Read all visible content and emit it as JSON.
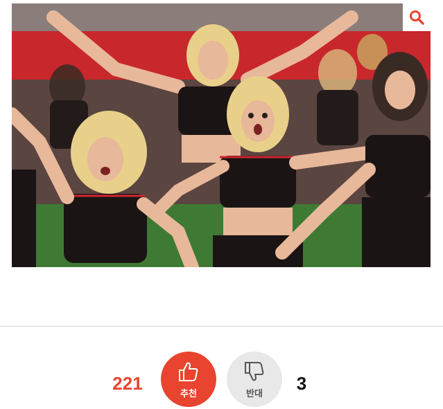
{
  "photo": {
    "icon": "cheerleaders-photo",
    "zoom_icon": "magnifier-icon",
    "colors": {
      "stadium_red": "#c8282c",
      "field_green": "#3f7a35",
      "uniform_black": "#1a1414",
      "uniform_trim": "#d3262f",
      "skin": "#e8b89a",
      "hair": "#e9d08a"
    }
  },
  "votes": {
    "up_count": "221",
    "up_label": "추천",
    "up_icon": "thumbs-up-icon",
    "down_label": "반대",
    "down_icon": "thumbs-down-icon",
    "down_count": "3",
    "colors": {
      "accent": "#e8442f",
      "neutral": "#e8e8e8"
    }
  }
}
